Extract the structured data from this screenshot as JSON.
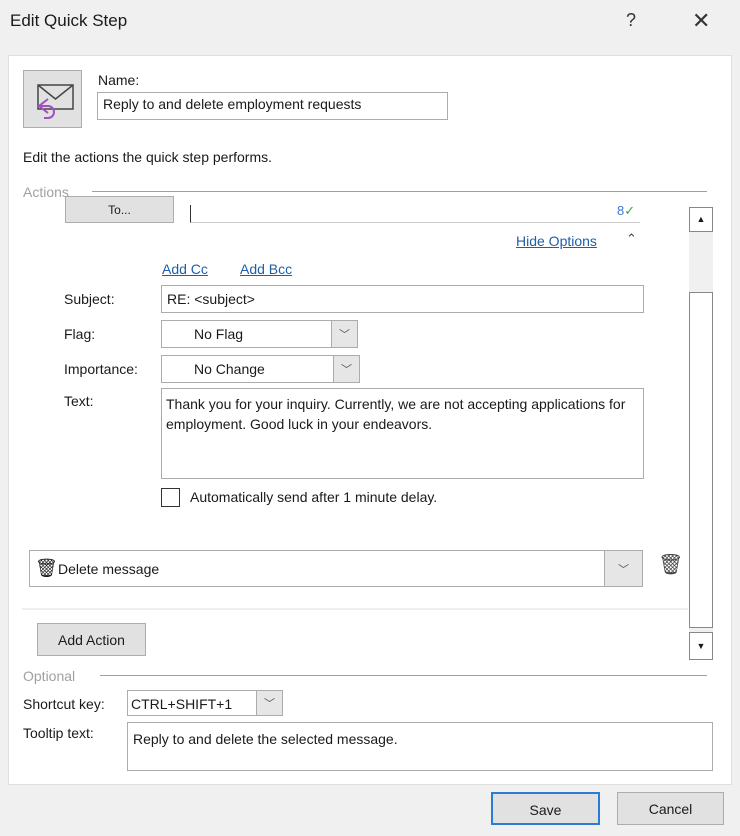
{
  "dialog": {
    "title": "Edit Quick Step",
    "help": "?",
    "close": "✕"
  },
  "name": {
    "label": "Name:",
    "value": "Reply to and delete employment requests"
  },
  "instructions": "Edit the actions the quick step performs.",
  "actions": {
    "legend": "Actions",
    "to_button": "To...",
    "hide_options": "Hide Options",
    "add_cc": "Add Cc",
    "add_bcc": "Add Bcc",
    "subject": {
      "label": "Subject:",
      "value": "RE: <subject>"
    },
    "flag": {
      "label": "Flag:",
      "value": "No Flag"
    },
    "importance": {
      "label": "Importance:",
      "value": "No Change"
    },
    "text": {
      "label": "Text:",
      "value": "Thank you for your inquiry. Currently, we are not accepting applications for employment. Good luck in your endeavors."
    },
    "auto_send": {
      "label": "Automatically send after 1 minute delay.",
      "checked": false
    },
    "second_action": "Delete message",
    "add_action": "Add Action"
  },
  "optional": {
    "legend": "Optional",
    "shortcut": {
      "label": "Shortcut key:",
      "value": "CTRL+SHIFT+1"
    },
    "tooltip": {
      "label": "Tooltip text:",
      "value": "Reply to and delete the selected message."
    }
  },
  "buttons": {
    "save": "Save",
    "cancel": "Cancel"
  }
}
